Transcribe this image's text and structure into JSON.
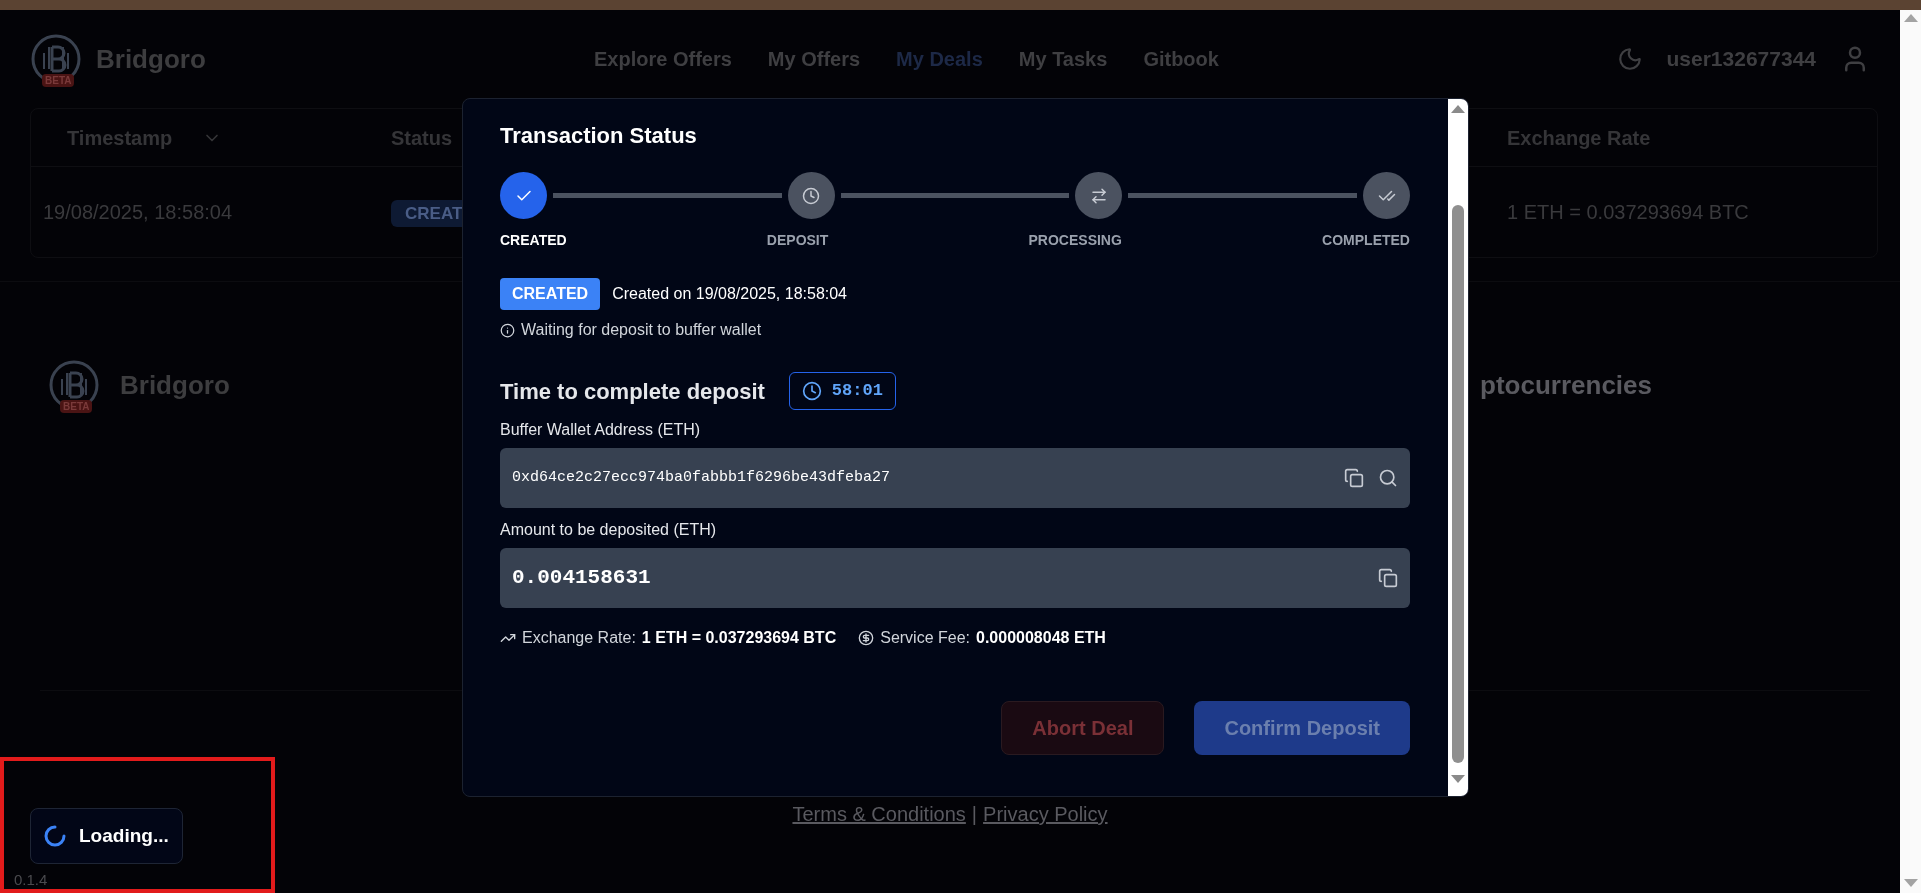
{
  "header": {
    "brand": "Bridgoro",
    "badge": "BETA",
    "username": "user132677344",
    "nav": [
      {
        "label": "Explore Offers",
        "selected": false
      },
      {
        "label": "My Offers",
        "selected": false
      },
      {
        "label": "My Deals",
        "selected": true
      },
      {
        "label": "My Tasks",
        "selected": false
      },
      {
        "label": "Gitbook",
        "selected": false
      }
    ]
  },
  "table": {
    "columns": [
      "Timestamp",
      "Status",
      "Exchange Rate"
    ],
    "rows": [
      {
        "timestamp": "19/08/2025, 18:58:04",
        "status": "CREAT",
        "exchange_rate": "1 ETH = 0.037293694 BTC"
      }
    ]
  },
  "footer": {
    "brand": "Bridgoro",
    "badge": "BETA",
    "tagline_fragment": "ptocurrencies",
    "links": [
      "Terms & Conditions",
      "Privacy Policy"
    ],
    "separator": "|",
    "version": "0.1.4"
  },
  "modal": {
    "title": "Transaction Status",
    "steps": [
      {
        "label": "CREATED",
        "done": true
      },
      {
        "label": "DEPOSIT",
        "done": false
      },
      {
        "label": "PROCESSING",
        "done": false
      },
      {
        "label": "COMPLETED",
        "done": false
      }
    ],
    "status_badge": "CREATED",
    "created_text": "Created on 19/08/2025, 18:58:04",
    "info": "Waiting for deposit to buffer wallet",
    "timer_label": "Time to complete deposit",
    "timer": "58:01",
    "fields": [
      {
        "kind": "address",
        "label": "Buffer Wallet Address (ETH)",
        "value": "0xd64ce2c27ecc974ba0fabbb1f6296be43dfeba27"
      },
      {
        "kind": "amount",
        "label": "Amount to be deposited (ETH)",
        "value": "0.004158631"
      }
    ],
    "exchange_rate": {
      "label": "Exchange Rate:",
      "value": "1 ETH = 0.037293694 BTC"
    },
    "service_fee": {
      "label": "Service Fee:",
      "value": "0.000008048 ETH"
    },
    "buttons": [
      {
        "kind": "danger",
        "label": "Abort Deal",
        "disabled": true
      },
      {
        "kind": "primary",
        "label": "Confirm Deposit",
        "disabled": true
      }
    ]
  },
  "toast": {
    "text": "Loading..."
  }
}
